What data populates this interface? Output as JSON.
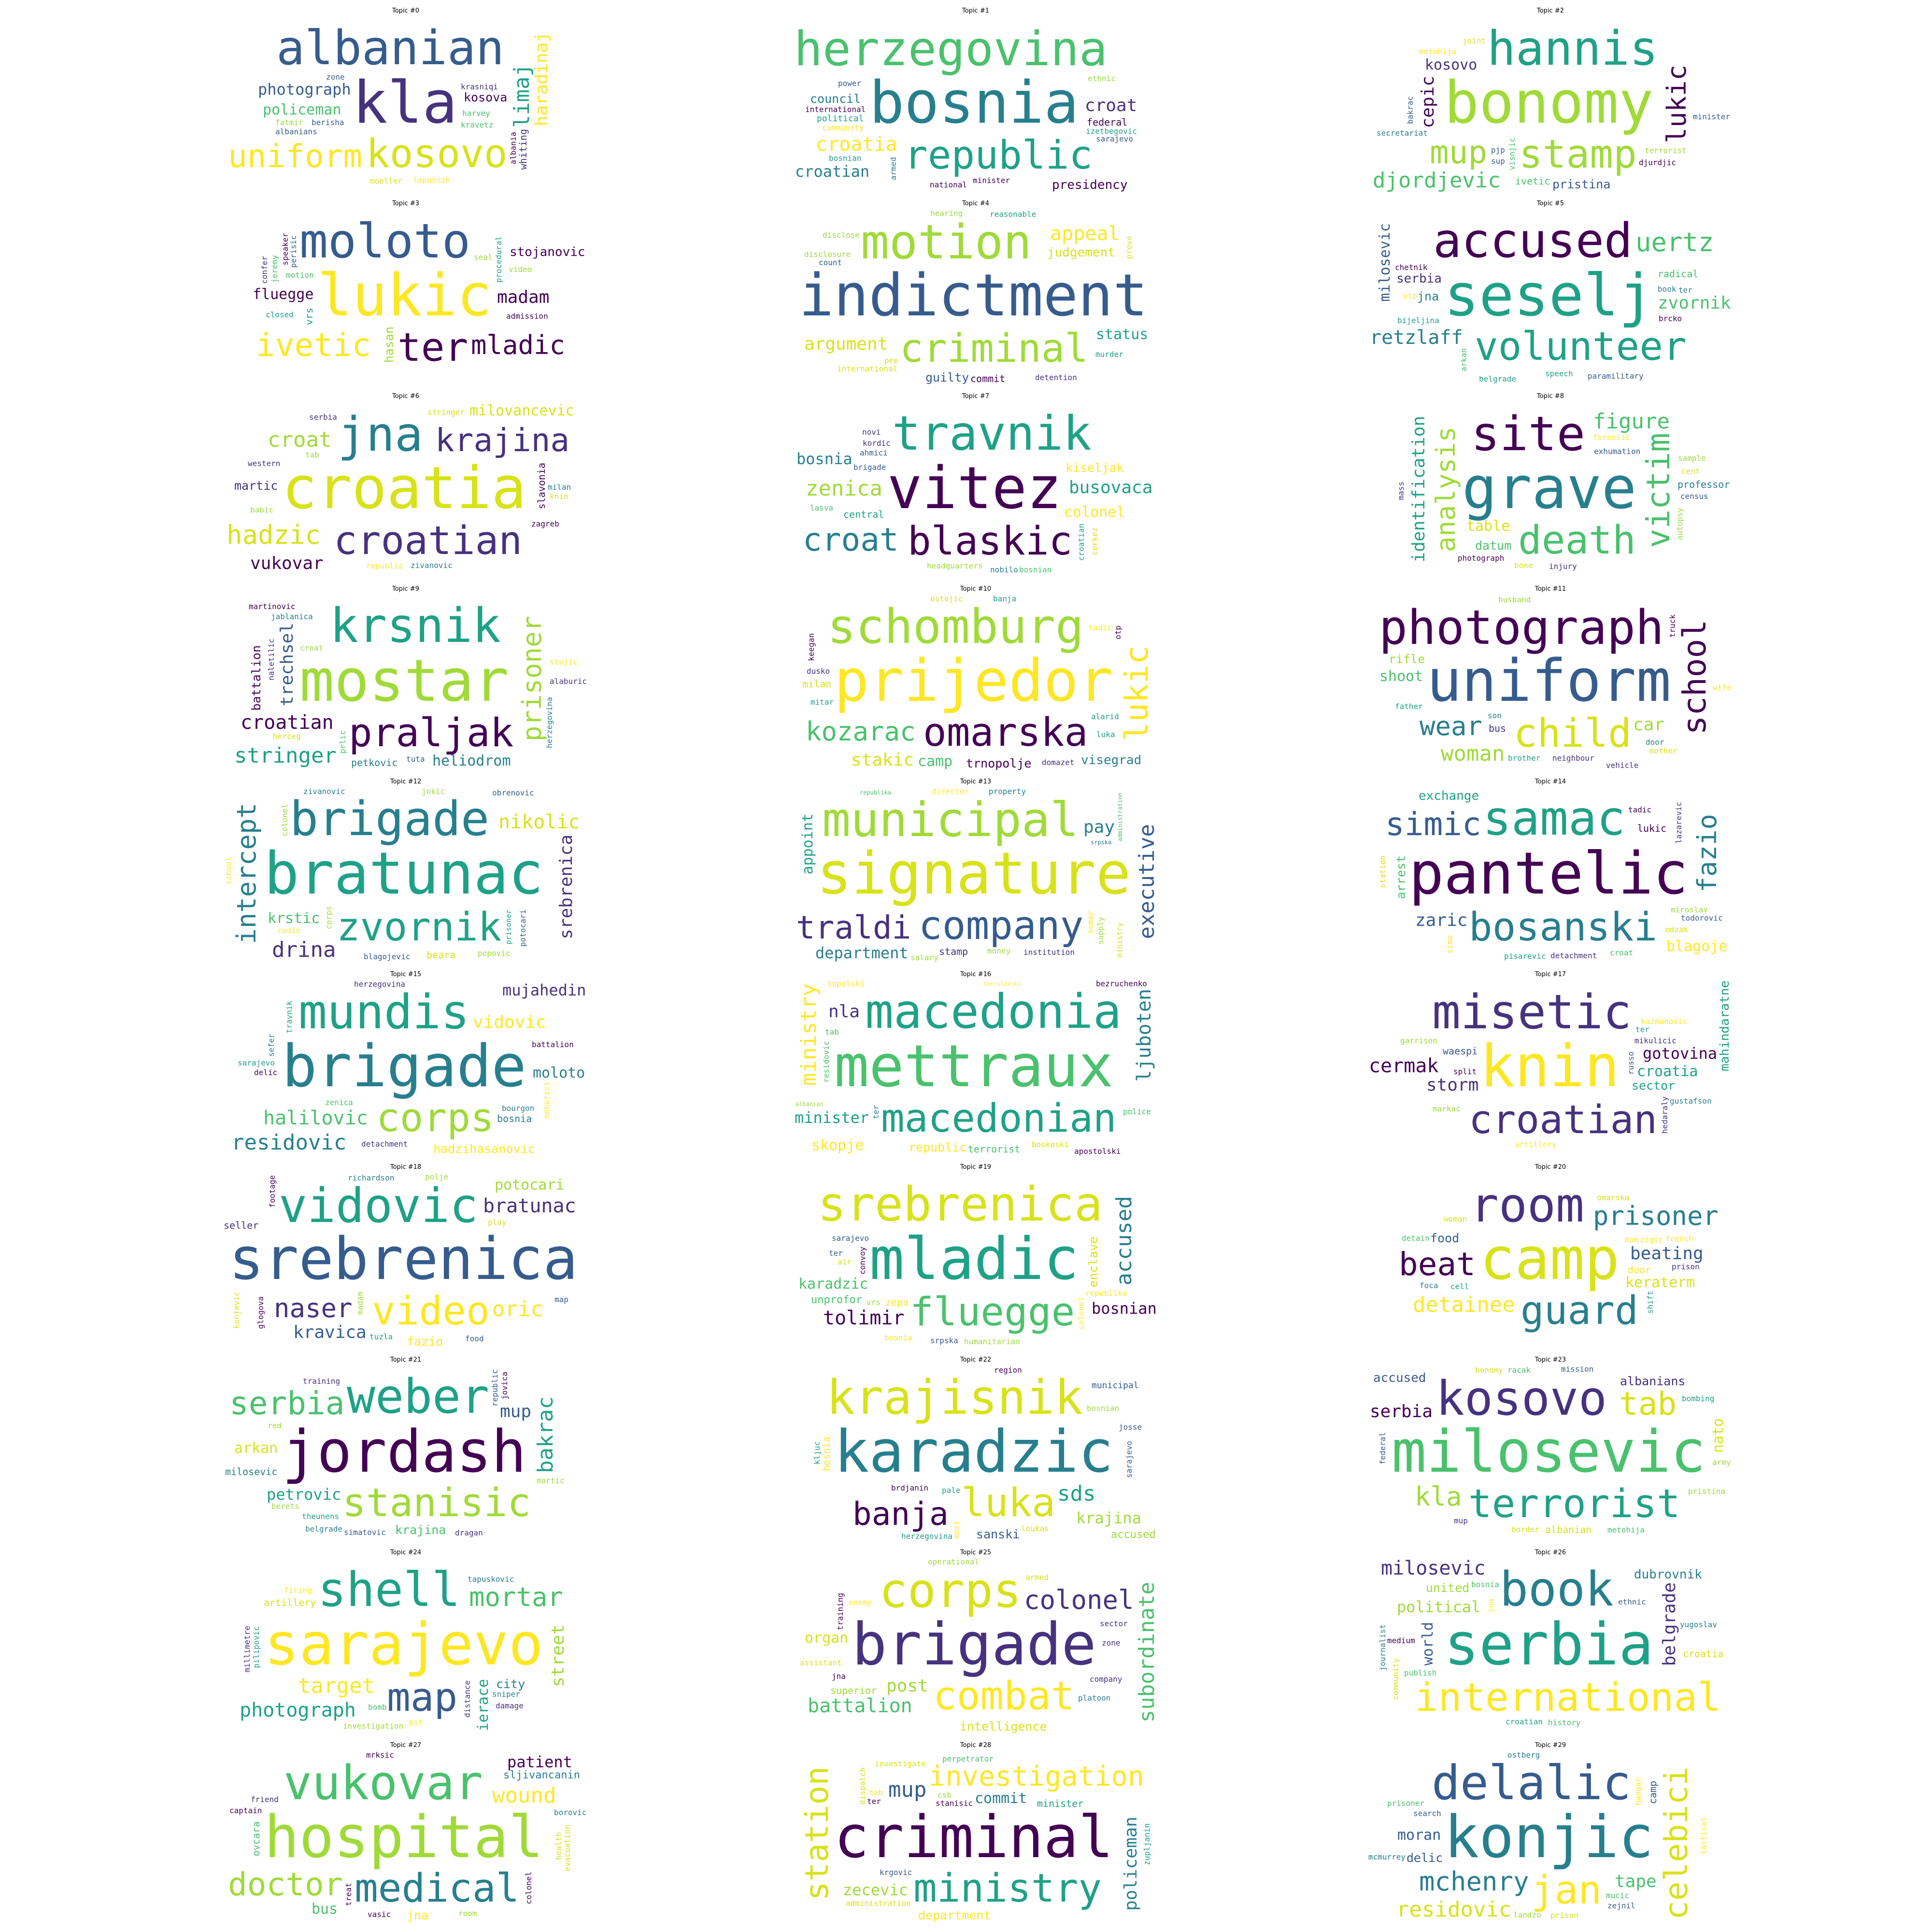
{
  "palette": [
    "#440154",
    "#46327e",
    "#365c8d",
    "#277f8e",
    "#1fa187",
    "#4ac16d",
    "#a0da39",
    "#d8e219",
    "#fde725"
  ],
  "topics": [
    {
      "title": "Topic #0",
      "words": [
        "kla",
        "albanian",
        "kosovo",
        "uniform",
        "photograph",
        "limaj",
        "haradinaj",
        "policeman",
        "kosova",
        "whiting",
        "harvey",
        "krasniqi",
        "kravetz",
        "berisha",
        "fatmir",
        "lapusnik",
        "albania",
        "zone",
        "albanians",
        "moeller"
      ]
    },
    {
      "title": "Topic #1",
      "words": [
        "bosnia",
        "herzegovina",
        "republic",
        "croatia",
        "croatian",
        "presidency",
        "croat",
        "political",
        "council",
        "federal",
        "armed",
        "community",
        "international",
        "izetbegovic",
        "power",
        "minister",
        "ethnic",
        "national",
        "sarajevo",
        "bosnian"
      ]
    },
    {
      "title": "Topic #2",
      "words": [
        "bonomy",
        "hannis",
        "stamp",
        "mup",
        "lukic",
        "djordjevic",
        "cepic",
        "kosovo",
        "pristina",
        "ivetic",
        "visnjic",
        "terrorist",
        "bakrac",
        "metohija",
        "djurdjic",
        "pjp",
        "sup",
        "joint",
        "secretariat",
        "minister"
      ]
    },
    {
      "title": "Topic #3",
      "words": [
        "lukic",
        "moloto",
        "ter",
        "ivetic",
        "mladic",
        "stojanovic",
        "madam",
        "fluegge",
        "hasan",
        "vrs",
        "procedural",
        "motion",
        "admission",
        "perisic",
        "jeremy",
        "video",
        "closed",
        "seal",
        "speaker",
        "confer"
      ]
    },
    {
      "title": "Topic #4",
      "words": [
        "indictment",
        "motion",
        "criminal",
        "appeal",
        "conference",
        "judgement",
        "argument",
        "status",
        "guilty",
        "commit",
        "count",
        "hearing",
        "reasonable",
        "pre",
        "murder",
        "disclosure",
        "detention",
        "international",
        "disclose",
        "prove"
      ]
    },
    {
      "title": "Topic #5",
      "words": [
        "seselj",
        "accused",
        "volunteer",
        "retzlaff",
        "uertz",
        "serbia",
        "zvornik",
        "milosevic",
        "jna",
        "radical",
        "bijeljina",
        "arkan",
        "brcko",
        "book",
        "speech",
        "otp",
        "ter",
        "paramilitary",
        "chetnik",
        "belgrade"
      ]
    },
    {
      "title": "Topic #6",
      "words": [
        "croatia",
        "jna",
        "croatian",
        "krajina",
        "hadzic",
        "croat",
        "vukovar",
        "milovancevic",
        "martic",
        "slavonia",
        "zivanovic",
        "babic",
        "stringer",
        "republic",
        "tab",
        "knin",
        "western",
        "zagreb",
        "serbia",
        "milan"
      ]
    },
    {
      "title": "Topic #7",
      "words": [
        "vitez",
        "travnik",
        "blaskic",
        "croat",
        "bosnia",
        "zenica",
        "busovaca",
        "colonel",
        "kiseljak",
        "central",
        "brigade",
        "kordic",
        "ahmici",
        "croatian",
        "headquarters",
        "nobilo",
        "cerkez",
        "bosnian",
        "novi",
        "lasva"
      ]
    },
    {
      "title": "Topic #8",
      "words": [
        "grave",
        "site",
        "death",
        "victim",
        "analysis",
        "figure",
        "identification",
        "table",
        "datum",
        "professor",
        "exhumation",
        "forensic",
        "injury",
        "census",
        "cent",
        "autopsy",
        "bone",
        "photograph",
        "mass",
        "sample"
      ]
    },
    {
      "title": "Topic #9",
      "words": [
        "mostar",
        "krsnik",
        "praljak",
        "croatian",
        "prisoner",
        "stringer",
        "trechsel",
        "heliodrom",
        "battalion",
        "petkovic",
        "croat",
        "tuta",
        "stojic",
        "prlic",
        "alaburic",
        "naletilic",
        "jablanica",
        "herceg",
        "martinovic",
        "herzegovina"
      ]
    },
    {
      "title": "Topic #10",
      "words": [
        "prijedor",
        "schomburg",
        "omarska",
        "lukic",
        "kozarac",
        "visegrad",
        "stakic",
        "camp",
        "trnopolje",
        "milan",
        "ostojic",
        "banja",
        "tadic",
        "mitar",
        "dusko",
        "alarid",
        "domazet",
        "keegan",
        "luka",
        "otp"
      ]
    },
    {
      "title": "Topic #11",
      "words": [
        "uniform",
        "photograph",
        "child",
        "school",
        "wear",
        "woman",
        "car",
        "shoot",
        "rifle",
        "bus",
        "son",
        "father",
        "brother",
        "truck",
        "neighbour",
        "door",
        "vehicle",
        "mother",
        "husband",
        "wife"
      ]
    },
    {
      "title": "Topic #12",
      "words": [
        "bratunac",
        "brigade",
        "zvornik",
        "nikolic",
        "intercept",
        "drina",
        "srebrenica",
        "krstic",
        "prisoner",
        "beara",
        "blagojevic",
        "potocari",
        "colonel",
        "school",
        "corps",
        "radio",
        "popovic",
        "zivanovic",
        "jokic",
        "obrenovic"
      ]
    },
    {
      "title": "Topic #13",
      "words": [
        "signature",
        "municipal",
        "company",
        "traldi",
        "department",
        "executive",
        "pay",
        "appoint",
        "ministry",
        "stamp",
        "money",
        "administration",
        "institution",
        "property",
        "director",
        "salary",
        "republika",
        "srpska",
        "supply",
        "somer"
      ]
    },
    {
      "title": "Topic #14",
      "words": [
        "pantelic",
        "samac",
        "bosanski",
        "simic",
        "fazio",
        "exchange",
        "zaric",
        "blagoje",
        "arrest",
        "lukic",
        "detachment",
        "pisarevic",
        "miroslav",
        "todorovic",
        "lazarevic",
        "station",
        "tadic",
        "odzak",
        "simo",
        "croat"
      ]
    },
    {
      "title": "Topic #15",
      "words": [
        "brigade",
        "mundis",
        "corps",
        "halilovic",
        "mujahedin",
        "residovic",
        "vidovic",
        "moloto",
        "hadzihasanovic",
        "bosnia",
        "zenica",
        "detachment",
        "delic",
        "sarajevo",
        "battalion",
        "travnik",
        "bourgon",
        "herzegovina",
        "mehurici",
        "sefer"
      ]
    },
    {
      "title": "Topic #16",
      "words": [
        "mettraux",
        "macedonia",
        "macedonian",
        "ljuboten",
        "minister",
        "ministry",
        "nla",
        "skopje",
        "republic",
        "terrorist",
        "boskoski",
        "apostolski",
        "bezruchenko",
        "residovic",
        "tab",
        "topolski",
        "tarculovski",
        "albanian",
        "ter",
        "police"
      ]
    },
    {
      "title": "Topic #17",
      "words": [
        "knin",
        "misetic",
        "croatian",
        "cermak",
        "gotovina",
        "mahindaratne",
        "storm",
        "croatia",
        "sector",
        "waespi",
        "russo",
        "split",
        "mikulicic",
        "markac",
        "ter",
        "kuzmanovic",
        "gustafson",
        "hedaraly",
        "garrison",
        "artillery"
      ]
    },
    {
      "title": "Topic #18",
      "words": [
        "srebrenica",
        "vidovic",
        "video",
        "bratunac",
        "naser",
        "oric",
        "kravica",
        "potocari",
        "fazio",
        "seller",
        "richardson",
        "glogova",
        "tuzla",
        "konjevic",
        "play",
        "madam",
        "map",
        "footage",
        "food",
        "polje"
      ]
    },
    {
      "title": "Topic #19",
      "words": [
        "mladic",
        "srebrenica",
        "fluegge",
        "tolimir",
        "bosnian",
        "accused",
        "unprofor",
        "karadzic",
        "enclave",
        "zepa",
        "convoy",
        "sarajevo",
        "vrs",
        "air",
        "humanitarian",
        "republika",
        "srpska",
        "ter",
        "bosnia",
        "colonel"
      ]
    },
    {
      "title": "Topic #20",
      "words": [
        "camp",
        "room",
        "guard",
        "beat",
        "prisoner",
        "detainee",
        "beating",
        "keraterm",
        "food",
        "door",
        "zigic",
        "woman",
        "cell",
        "shift",
        "omarska",
        "foca",
        "french",
        "dom",
        "detain",
        "prison"
      ]
    },
    {
      "title": "Topic #21",
      "words": [
        "jordash",
        "weber",
        "stanisic",
        "serbia",
        "petrovic",
        "bakrac",
        "mup",
        "arkan",
        "krajina",
        "milosevic",
        "simatovic",
        "theunens",
        "republic",
        "red",
        "berets",
        "martic",
        "belgrade",
        "training",
        "jovica",
        "dragan"
      ]
    },
    {
      "title": "Topic #22",
      "words": [
        "karadzic",
        "krajisnik",
        "luka",
        "banja",
        "krajina",
        "sds",
        "accused",
        "municipal",
        "sanski",
        "bosnia",
        "brdjanin",
        "bosnian",
        "sarajevo",
        "pale",
        "kljuc",
        "loukas",
        "most",
        "region",
        "josse",
        "herzegovina"
      ]
    },
    {
      "title": "Topic #23",
      "words": [
        "milosevic",
        "kosovo",
        "terrorist",
        "tab",
        "kla",
        "accused",
        "serbia",
        "nato",
        "albanians",
        "albanian",
        "border",
        "mission",
        "metohija",
        "racak",
        "bonomy",
        "pristina",
        "federal",
        "mup",
        "bombing",
        "army"
      ]
    },
    {
      "title": "Topic #24",
      "words": [
        "sarajevo",
        "shell",
        "map",
        "photograph",
        "mortar",
        "target",
        "street",
        "ierace",
        "city",
        "artillery",
        "sniper",
        "bomb",
        "hit",
        "firing",
        "distance",
        "pilipovic",
        "tapuskovic",
        "damage",
        "millimetre",
        "investigation"
      ]
    },
    {
      "title": "Topic #25",
      "words": [
        "brigade",
        "corps",
        "combat",
        "battalion",
        "colonel",
        "subordinate",
        "post",
        "organ",
        "intelligence",
        "superior",
        "zone",
        "sector",
        "armed",
        "enemy",
        "company",
        "assistant",
        "operational",
        "platoon",
        "jna",
        "training"
      ]
    },
    {
      "title": "Topic #26",
      "words": [
        "serbia",
        "book",
        "international",
        "milosevic",
        "political",
        "dubrovnik",
        "belgrade",
        "world",
        "united",
        "croatia",
        "ethnic",
        "jna",
        "history",
        "croatian",
        "publish",
        "bosnia",
        "medium",
        "yugoslav",
        "community",
        "journalist"
      ]
    },
    {
      "title": "Topic #27",
      "words": [
        "hospital",
        "vukovar",
        "medical",
        "doctor",
        "patient",
        "wound",
        "sljivancanin",
        "bus",
        "jna",
        "ovcara",
        "health",
        "treat",
        "evacuation",
        "vasic",
        "room",
        "colonel",
        "friend",
        "borovic",
        "captain",
        "mrksic"
      ]
    },
    {
      "title": "Topic #28",
      "words": [
        "criminal",
        "investigation",
        "ministry",
        "station",
        "zecevic",
        "mup",
        "policeman",
        "commit",
        "department",
        "minister",
        "investigate",
        "dispatch",
        "zupljanin",
        "perpetrator",
        "stanisic",
        "administration",
        "csb",
        "krgovic",
        "ter",
        "tab"
      ]
    },
    {
      "title": "Topic #29",
      "words": [
        "konjic",
        "delalic",
        "jan",
        "celebici",
        "mchenry",
        "residovic",
        "tape",
        "moran",
        "delic",
        "camp",
        "mucic",
        "hangar",
        "search",
        "prison",
        "zejnil",
        "prisoner",
        "ostberg",
        "tactical",
        "landzo",
        "mcmurrey"
      ]
    }
  ]
}
